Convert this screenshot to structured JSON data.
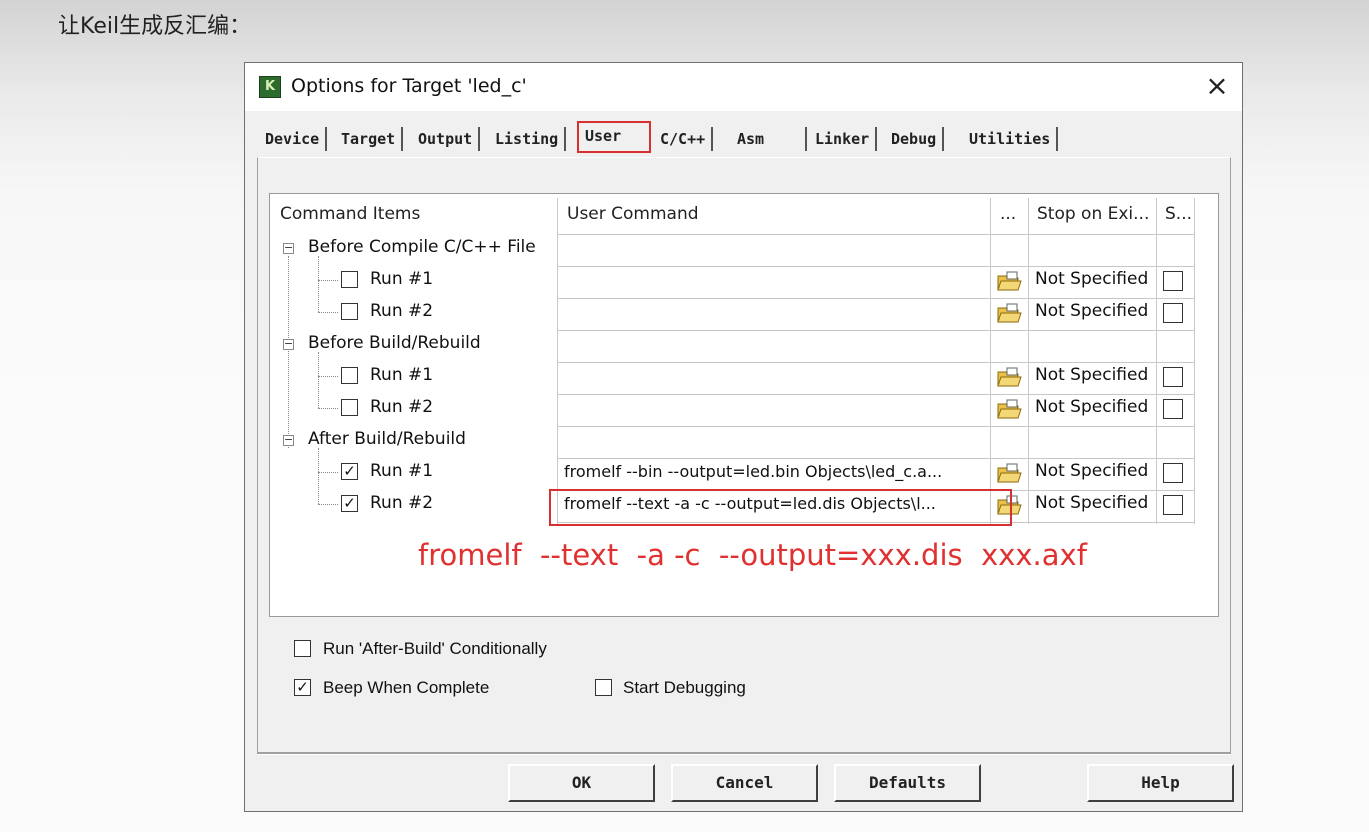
{
  "heading": "让Keil生成反汇编：",
  "dialog": {
    "title": "Options for Target 'led_c'",
    "close_glyph": "×",
    "icon_glyph": "K",
    "tabs": [
      "Device",
      "Target",
      "Output",
      "Listing",
      "User",
      "C/C++",
      "Asm",
      "Linker",
      "Debug",
      "Utilities"
    ],
    "active_tab": "User",
    "columns": {
      "items": "Command Items",
      "command": "User Command",
      "browse": "...",
      "stop": "Stop on Exi...",
      "s": "S..."
    },
    "groups": [
      {
        "label": "Before Compile C/C++ File",
        "expander": "−",
        "runs": [
          {
            "label": "Run #1",
            "checked": "",
            "command": "",
            "stop": "Not Specified"
          },
          {
            "label": "Run #2",
            "checked": "",
            "command": "",
            "stop": "Not Specified"
          }
        ]
      },
      {
        "label": "Before Build/Rebuild",
        "expander": "−",
        "runs": [
          {
            "label": "Run #1",
            "checked": "",
            "command": "",
            "stop": "Not Specified"
          },
          {
            "label": "Run #2",
            "checked": "",
            "command": "",
            "stop": "Not Specified"
          }
        ]
      },
      {
        "label": "After Build/Rebuild",
        "expander": "−",
        "runs": [
          {
            "label": "Run #1",
            "checked": "✓",
            "command": "fromelf  --bin  --output=led.bin  Objects\\led_c.a...",
            "stop": "Not Specified"
          },
          {
            "label": "Run #2",
            "checked": "✓",
            "command": "fromelf  --text  -a -c  --output=led.dis  Objects\\l...",
            "stop": "Not Specified"
          }
        ]
      }
    ],
    "annotation": "fromelf  --text  -a -c  --output=xxx.dis  xxx.axf",
    "options": {
      "run_after_build": {
        "label": "Run 'After-Build' Conditionally",
        "checked": ""
      },
      "beep": {
        "label": "Beep When Complete",
        "checked": "✓"
      },
      "start_debugging": {
        "label": "Start Debugging",
        "checked": ""
      }
    },
    "buttons": {
      "ok": "OK",
      "cancel": "Cancel",
      "defaults": "Defaults",
      "help": "Help"
    }
  },
  "colors": {
    "highlight": "#d63030",
    "annotation": "#e03030"
  }
}
